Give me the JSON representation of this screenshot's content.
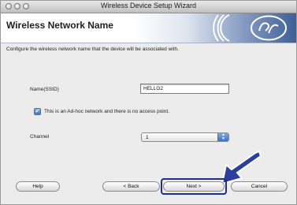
{
  "window": {
    "title": "Wireless Device Setup Wizard"
  },
  "header": {
    "title": "Wireless Network Name"
  },
  "instructions": "Configure the wireless network name that the device will be associated with.",
  "form": {
    "ssid_label": "Name(SSID)",
    "ssid_value": "HELLO2",
    "adhoc_checkbox_label": "This is an Ad-hoc network and there is no access point.",
    "adhoc_checked": true,
    "channel_label": "Channel",
    "channel_value": "1"
  },
  "buttons": {
    "help": "Help",
    "back": "< Back",
    "next": "Next >",
    "cancel": "Cancel"
  },
  "colors": {
    "header_gradient_end": "#3e5f97",
    "highlight_arrow": "#2a3f9e",
    "checkbox_blue": "#3d74c8"
  }
}
